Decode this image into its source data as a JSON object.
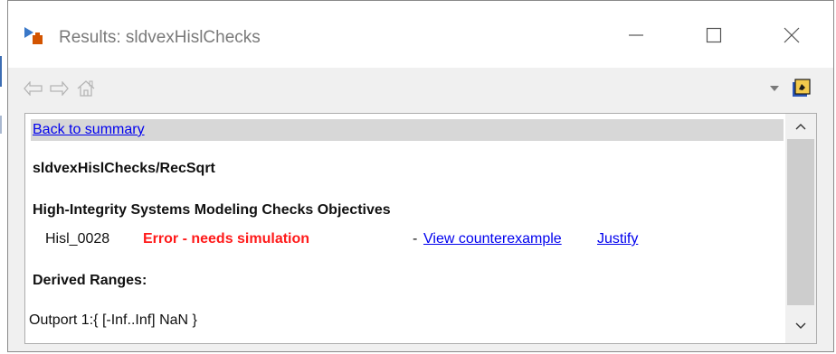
{
  "window": {
    "title": "Results: sldvexHislChecks"
  },
  "content": {
    "back_link": "Back to summary",
    "block_path": "sldvexHislChecks/RecSqrt",
    "objectives_heading": "High-Integrity Systems Modeling Checks Objectives",
    "objective": {
      "id": "Hisl_0028",
      "status": "Error - needs simulation",
      "separator": "-",
      "view_link": "View counterexample",
      "justify_link": "Justify"
    },
    "ranges_heading": "Derived Ranges:",
    "outport_range": "Outport 1:{ [-Inf..Inf] NaN }"
  },
  "icons": {
    "app": "simulink-design-verifier-icon",
    "back": "back-arrow-icon",
    "forward": "forward-arrow-icon",
    "home": "home-icon",
    "dropdown": "dropdown-triangle-icon",
    "highlight": "highlight-model-icon"
  },
  "colors": {
    "error_status": "#ff1a1a",
    "link": "#0000ee",
    "back_bar": "#d7d7d7",
    "title_text": "#7a7a7a"
  }
}
